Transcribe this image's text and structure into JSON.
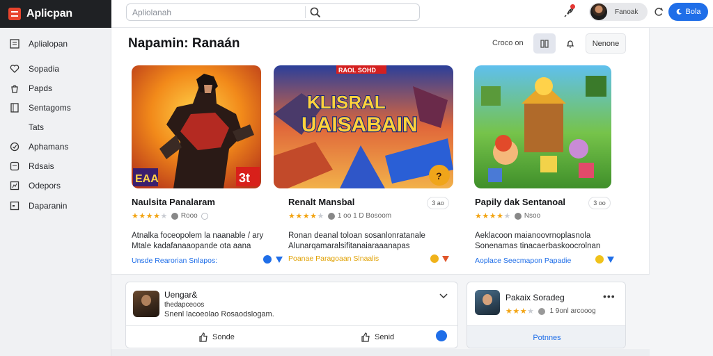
{
  "app": {
    "name": "Aplicpan",
    "search_placeholder": "Apliolanah",
    "user_name": "Fanoak",
    "cta_label": "Bola",
    "accent": "#1f6ee8",
    "brand_color": "#e8442d"
  },
  "sidebar": {
    "items": [
      {
        "label": "Aplialopan",
        "icon": "grid-icon"
      },
      {
        "label": "Sopadia",
        "icon": "heart-icon"
      },
      {
        "label": "Papds",
        "icon": "bag-icon"
      },
      {
        "label": "Sentagoms",
        "icon": "bookmark-icon"
      },
      {
        "label": "Tats",
        "icon": ""
      },
      {
        "label": "Aphamans",
        "icon": "clock-icon"
      },
      {
        "label": "Rdsais",
        "icon": "chat-icon"
      },
      {
        "label": "Odepors",
        "icon": "chart-icon"
      },
      {
        "label": "Daparanin",
        "icon": "square-icon"
      }
    ]
  },
  "main": {
    "title": "Napamin: Ranaán",
    "sort_label": "Croco on",
    "filter_label": "Nenone",
    "cards": [
      {
        "art_overlay_left": "EAA",
        "art_overlay_right": "3t",
        "title": "Naulsita Panalaram",
        "stars": 4,
        "rating_text": "Rooo",
        "desc_line1": "Atnalka foceopolem la naanable / ary",
        "desc_line2": "Mtale kadafanaaopande ota aana",
        "link_text": "Unsde Rearorian Snlapos:",
        "link_color": "#1f6ee8"
      },
      {
        "art_banner": "RAOL SOHD",
        "art_title_top": "KLISRAL",
        "art_title_bottom": "UAISABAIN",
        "title": "Renalt Mansbal",
        "badge": "3 ao",
        "stars": 4,
        "rating_text": "1 oo 1 D Bosoom",
        "desc_line1": "Ronan deanal toloan sosanlonratanale",
        "desc_line2": "Alunarqamaralsifitanaiaraaanapas",
        "link_text": "Poanae Paragoaan Slnaalis",
        "link_color": "#e0a000"
      },
      {
        "title": "Papily dak Sentanoal",
        "badge": "3 oo",
        "stars": 4,
        "rating_text": "Nsoo",
        "desc_line1": "Aeklacoon maianoovrnoplasnola",
        "desc_line2": "Sonenamas tinacaerbaskoocrolnan",
        "link_text": "Aoplace Seecmapon Papadie",
        "link_color": "#1f6ee8"
      }
    ]
  },
  "post": {
    "name": "Uengar&",
    "subtitle": "thedapceoos",
    "text": "Snenl lacoeolao Rosaodslogam.",
    "action_left": "Sonde",
    "action_right": "Senid"
  },
  "mini": {
    "name": "Pakaix Soradeg",
    "stars": 3,
    "rating_text": "1 9onl arcooog",
    "footer_label": "Potnnes"
  }
}
